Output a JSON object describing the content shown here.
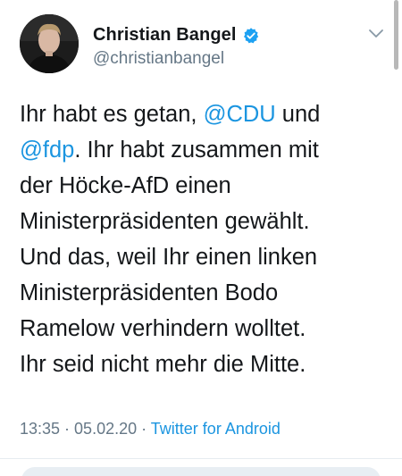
{
  "tweet": {
    "author": {
      "name": "Christian Bangel",
      "handle": "@christianbangel",
      "verified": true
    },
    "text_lines": [
      {
        "before": "Ihr habt es getan, ",
        "mention": "@CDU",
        "after": " und"
      },
      {
        "before": "",
        "mention": "@fdp",
        "after": ". Ihr habt zusammen mit"
      },
      {
        "before": "der Höcke-AfD einen",
        "mention": "",
        "after": ""
      },
      {
        "before": "Ministerpräsidenten gewählt.",
        "mention": "",
        "after": ""
      },
      {
        "before": "Und das, weil Ihr einen linken",
        "mention": "",
        "after": ""
      },
      {
        "before": "Ministerpräsidenten Bodo",
        "mention": "",
        "after": ""
      },
      {
        "before": "Ramelow verhindern wolltet.",
        "mention": "",
        "after": ""
      },
      {
        "before": "Ihr seid nicht mehr die Mitte.",
        "mention": "",
        "after": ""
      }
    ],
    "time": "13:35",
    "separator": " · ",
    "date": "05.02.20",
    "source": "Twitter for Android"
  },
  "icons": {
    "verified": "verified-badge-icon",
    "menu": "chevron-down-icon"
  },
  "colors": {
    "link": "#1b95e0",
    "text": "#14171a",
    "secondary": "#657786",
    "verified": "#1da1f2"
  }
}
